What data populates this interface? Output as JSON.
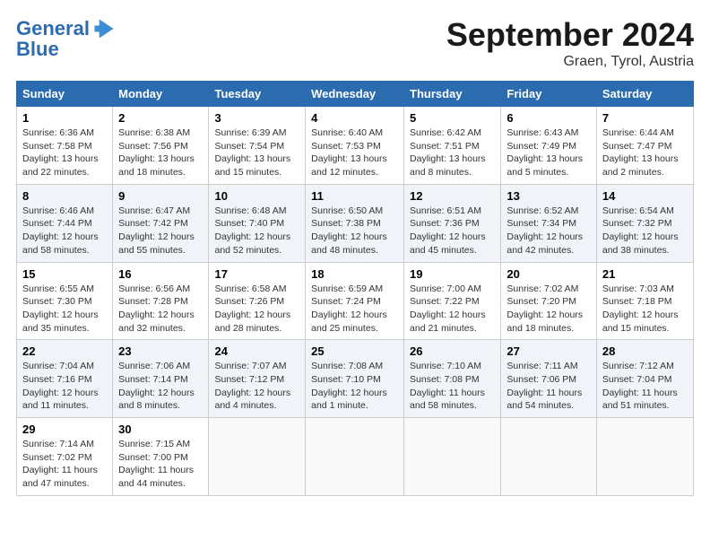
{
  "header": {
    "logo_line1": "General",
    "logo_line2": "Blue",
    "month": "September 2024",
    "location": "Graen, Tyrol, Austria"
  },
  "weekdays": [
    "Sunday",
    "Monday",
    "Tuesday",
    "Wednesday",
    "Thursday",
    "Friday",
    "Saturday"
  ],
  "weeks": [
    [
      {
        "day": "1",
        "detail": "Sunrise: 6:36 AM\nSunset: 7:58 PM\nDaylight: 13 hours\nand 22 minutes."
      },
      {
        "day": "2",
        "detail": "Sunrise: 6:38 AM\nSunset: 7:56 PM\nDaylight: 13 hours\nand 18 minutes."
      },
      {
        "day": "3",
        "detail": "Sunrise: 6:39 AM\nSunset: 7:54 PM\nDaylight: 13 hours\nand 15 minutes."
      },
      {
        "day": "4",
        "detail": "Sunrise: 6:40 AM\nSunset: 7:53 PM\nDaylight: 13 hours\nand 12 minutes."
      },
      {
        "day": "5",
        "detail": "Sunrise: 6:42 AM\nSunset: 7:51 PM\nDaylight: 13 hours\nand 8 minutes."
      },
      {
        "day": "6",
        "detail": "Sunrise: 6:43 AM\nSunset: 7:49 PM\nDaylight: 13 hours\nand 5 minutes."
      },
      {
        "day": "7",
        "detail": "Sunrise: 6:44 AM\nSunset: 7:47 PM\nDaylight: 13 hours\nand 2 minutes."
      }
    ],
    [
      {
        "day": "8",
        "detail": "Sunrise: 6:46 AM\nSunset: 7:44 PM\nDaylight: 12 hours\nand 58 minutes."
      },
      {
        "day": "9",
        "detail": "Sunrise: 6:47 AM\nSunset: 7:42 PM\nDaylight: 12 hours\nand 55 minutes."
      },
      {
        "day": "10",
        "detail": "Sunrise: 6:48 AM\nSunset: 7:40 PM\nDaylight: 12 hours\nand 52 minutes."
      },
      {
        "day": "11",
        "detail": "Sunrise: 6:50 AM\nSunset: 7:38 PM\nDaylight: 12 hours\nand 48 minutes."
      },
      {
        "day": "12",
        "detail": "Sunrise: 6:51 AM\nSunset: 7:36 PM\nDaylight: 12 hours\nand 45 minutes."
      },
      {
        "day": "13",
        "detail": "Sunrise: 6:52 AM\nSunset: 7:34 PM\nDaylight: 12 hours\nand 42 minutes."
      },
      {
        "day": "14",
        "detail": "Sunrise: 6:54 AM\nSunset: 7:32 PM\nDaylight: 12 hours\nand 38 minutes."
      }
    ],
    [
      {
        "day": "15",
        "detail": "Sunrise: 6:55 AM\nSunset: 7:30 PM\nDaylight: 12 hours\nand 35 minutes."
      },
      {
        "day": "16",
        "detail": "Sunrise: 6:56 AM\nSunset: 7:28 PM\nDaylight: 12 hours\nand 32 minutes."
      },
      {
        "day": "17",
        "detail": "Sunrise: 6:58 AM\nSunset: 7:26 PM\nDaylight: 12 hours\nand 28 minutes."
      },
      {
        "day": "18",
        "detail": "Sunrise: 6:59 AM\nSunset: 7:24 PM\nDaylight: 12 hours\nand 25 minutes."
      },
      {
        "day": "19",
        "detail": "Sunrise: 7:00 AM\nSunset: 7:22 PM\nDaylight: 12 hours\nand 21 minutes."
      },
      {
        "day": "20",
        "detail": "Sunrise: 7:02 AM\nSunset: 7:20 PM\nDaylight: 12 hours\nand 18 minutes."
      },
      {
        "day": "21",
        "detail": "Sunrise: 7:03 AM\nSunset: 7:18 PM\nDaylight: 12 hours\nand 15 minutes."
      }
    ],
    [
      {
        "day": "22",
        "detail": "Sunrise: 7:04 AM\nSunset: 7:16 PM\nDaylight: 12 hours\nand 11 minutes."
      },
      {
        "day": "23",
        "detail": "Sunrise: 7:06 AM\nSunset: 7:14 PM\nDaylight: 12 hours\nand 8 minutes."
      },
      {
        "day": "24",
        "detail": "Sunrise: 7:07 AM\nSunset: 7:12 PM\nDaylight: 12 hours\nand 4 minutes."
      },
      {
        "day": "25",
        "detail": "Sunrise: 7:08 AM\nSunset: 7:10 PM\nDaylight: 12 hours\nand 1 minute."
      },
      {
        "day": "26",
        "detail": "Sunrise: 7:10 AM\nSunset: 7:08 PM\nDaylight: 11 hours\nand 58 minutes."
      },
      {
        "day": "27",
        "detail": "Sunrise: 7:11 AM\nSunset: 7:06 PM\nDaylight: 11 hours\nand 54 minutes."
      },
      {
        "day": "28",
        "detail": "Sunrise: 7:12 AM\nSunset: 7:04 PM\nDaylight: 11 hours\nand 51 minutes."
      }
    ],
    [
      {
        "day": "29",
        "detail": "Sunrise: 7:14 AM\nSunset: 7:02 PM\nDaylight: 11 hours\nand 47 minutes."
      },
      {
        "day": "30",
        "detail": "Sunrise: 7:15 AM\nSunset: 7:00 PM\nDaylight: 11 hours\nand 44 minutes."
      },
      {
        "day": "",
        "detail": ""
      },
      {
        "day": "",
        "detail": ""
      },
      {
        "day": "",
        "detail": ""
      },
      {
        "day": "",
        "detail": ""
      },
      {
        "day": "",
        "detail": ""
      }
    ]
  ]
}
